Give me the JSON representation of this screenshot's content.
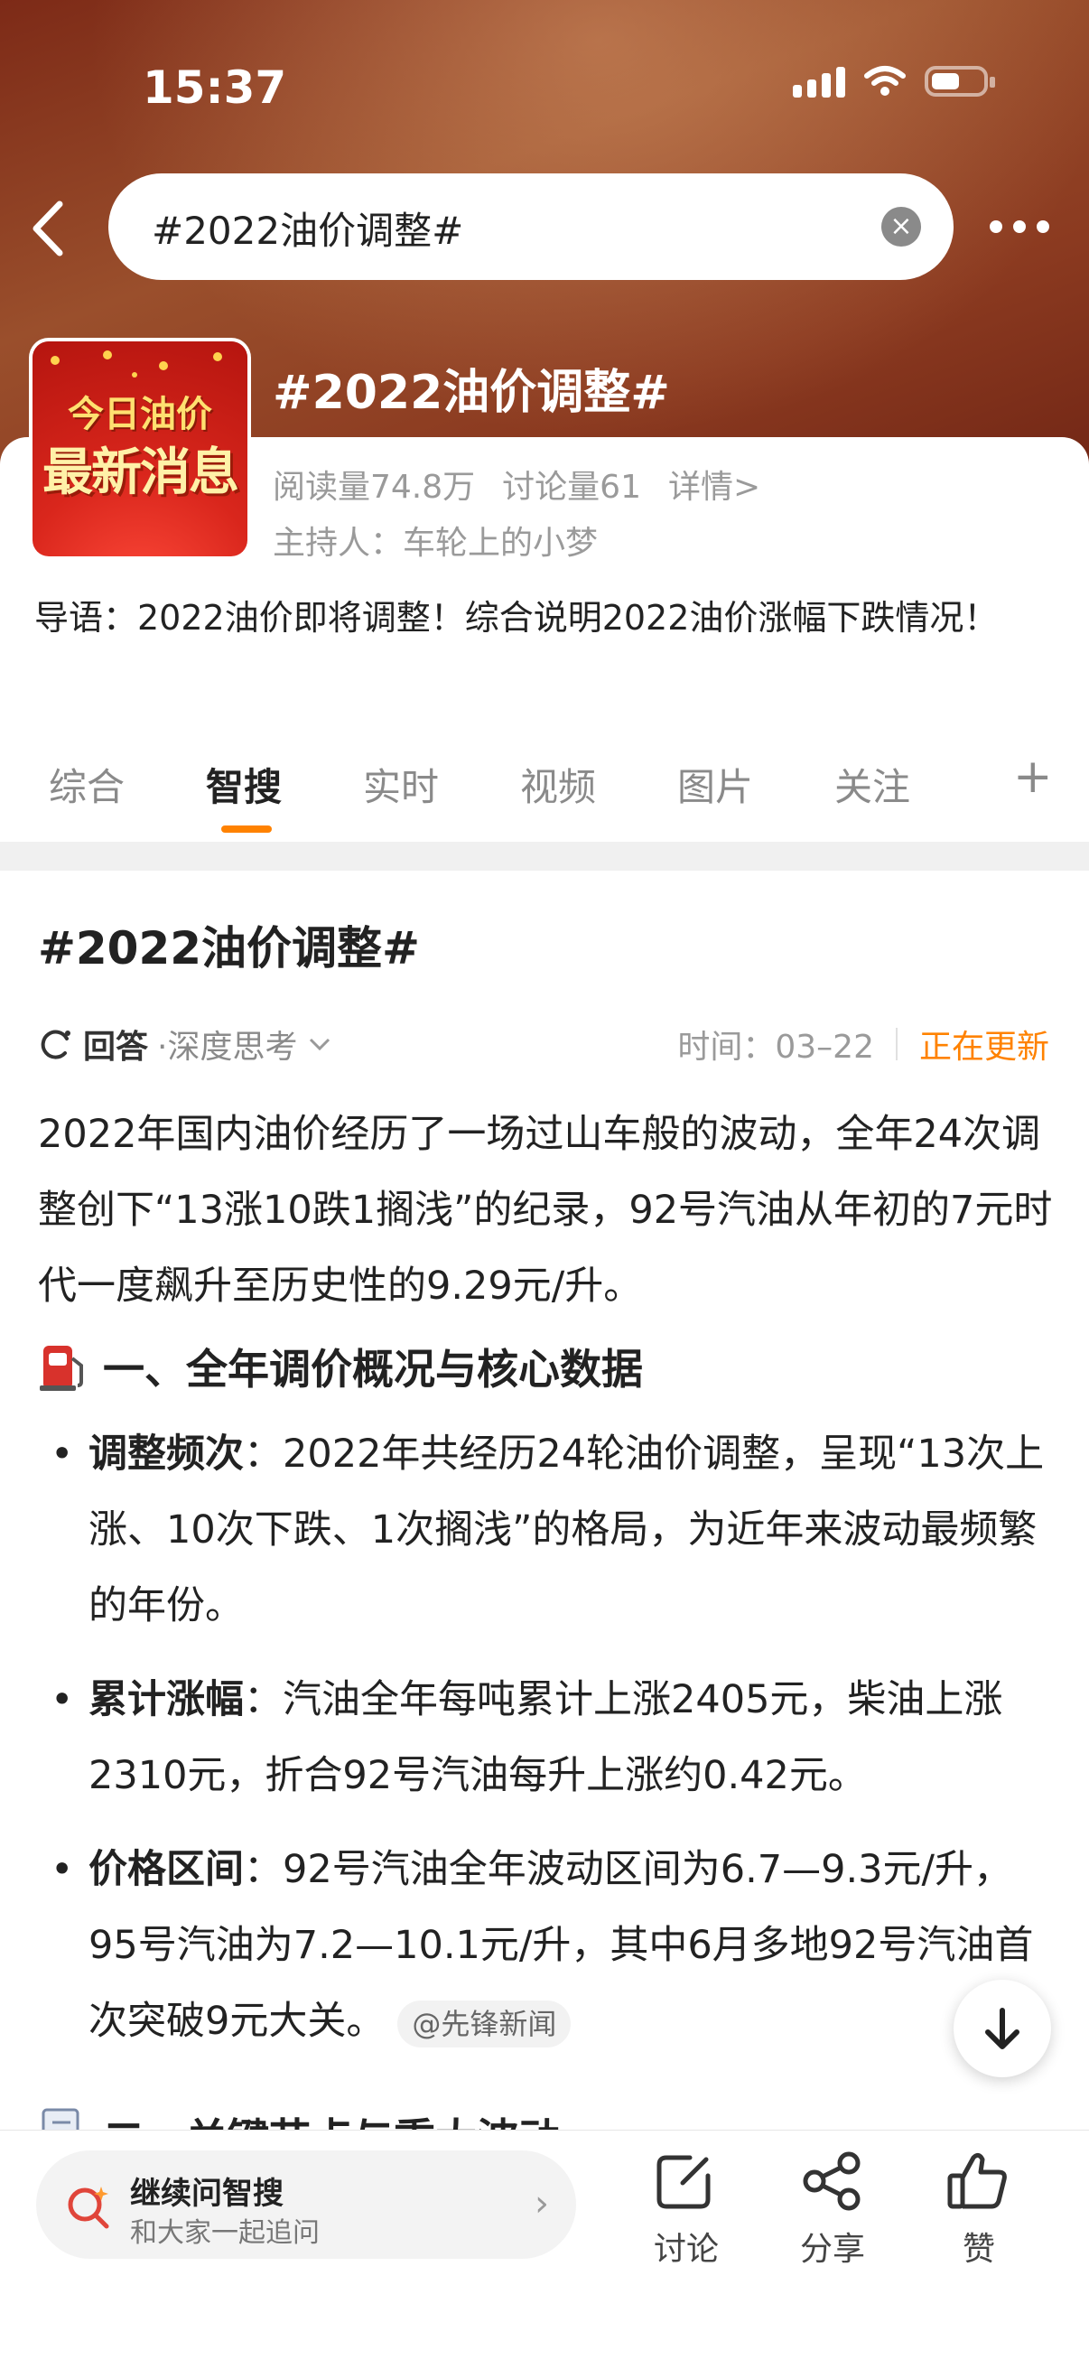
{
  "status_bar": {
    "time": "15:37"
  },
  "nav": {
    "search_text": "#2022油价调整#"
  },
  "topic": {
    "title": "#2022油价调整#",
    "cover_line1": "今日油价",
    "cover_line2": "最新消息",
    "reads": "阅读量74.8万",
    "discussions": "讨论量61",
    "details": "详情>",
    "host": "主持人：车轮上的小梦",
    "guide": "导语：2022油价即将调整！综合说明2022油价涨幅下跌情况！"
  },
  "tabs": [
    {
      "label": "综合",
      "active": false
    },
    {
      "label": "智搜",
      "active": true
    },
    {
      "label": "实时",
      "active": false
    },
    {
      "label": "视频",
      "active": false
    },
    {
      "label": "图片",
      "active": false
    },
    {
      "label": "关注",
      "active": false
    },
    {
      "label": "+",
      "active": false
    }
  ],
  "content": {
    "title": "#2022油价调整#",
    "answer_label": "回答",
    "mode": "·深度思考",
    "time": "时间：03–22",
    "live": "正在更新",
    "intro": "2022年国内油价经历了一场过山车般的波动，全年24次调整创下“13涨10跌1搁浅”的纪录，92号汽油从年初的7元时代一度飙升至历史性的9.29元/升。",
    "section1": "一、全年调价概况与核心数据",
    "bullets": [
      {
        "key": "调整频次",
        "text": "：2022年共经历24轮油价调整，呈现“13次上涨、10次下跌、1次搁浅”的格局，为近年来波动最频繁的年份。"
      },
      {
        "key": "累计涨幅",
        "text": "：汽油全年每吨累计上涨2405元，柴油上涨2310元，折合92号汽油每升上涨约0.42元。"
      },
      {
        "key": "价格区间",
        "text": "：92号汽油全年波动区间为6.7—9.3元/升，95号汽油为7.2—10.1元/升，其中6月多地92号汽油首次突破9元大关。",
        "source": "@先锋新闻"
      }
    ],
    "section2_peek": "二、关键节点与重大波动"
  },
  "bottom": {
    "ask_title": "继续问智搜",
    "ask_sub": "和大家一起追问",
    "discuss": "讨论",
    "share": "分享",
    "like": "赞"
  },
  "colors": {
    "accent": "#ff8200",
    "hero": "#8b3a20"
  }
}
